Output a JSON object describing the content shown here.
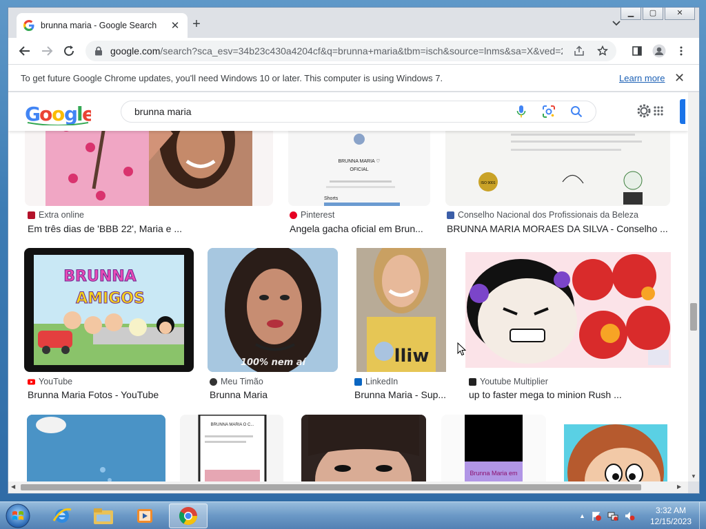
{
  "browser": {
    "tab_title": "brunna maria - Google Search",
    "url_host": "google.com",
    "url_path": "/search?sca_esv=34b23c430a4204cf&q=brunna+maria&tbm=isch&source=lnms&sa=X&ved=2...",
    "infobar_text": "To get future Google Chrome updates, you'll need Windows 10 or later. This computer is using Windows 7.",
    "infobar_link": "Learn more"
  },
  "search": {
    "query": "brunna maria"
  },
  "results": [
    {
      "source": "Extra online",
      "title": "Em três dias de 'BBB 22', Maria e ...",
      "src_color": "#b3122a"
    },
    {
      "source": "Pinterest",
      "title": "Angela gacha oficial em Brun...",
      "src_color": "#e60023"
    },
    {
      "source": "Conselho Nacional dos Profissionais da Beleza",
      "title": "BRUNNA MARIA MORAES DA SILVA - Conselho ...",
      "src_color": "#3b5ea8"
    },
    {
      "source": "YouTube",
      "title": "Brunna Maria Fotos - YouTube",
      "src_color": "#ff0000"
    },
    {
      "source": "Meu Timão",
      "title": "Brunna Maria",
      "src_color": "#333333"
    },
    {
      "source": "LinkedIn",
      "title": "Brunna Maria - Sup...",
      "src_color": "#0a66c2"
    },
    {
      "source": "Youtube Multiplier",
      "title": "up to faster mega to minion Rush ...",
      "src_color": "#222222"
    }
  ],
  "thumb_text": {
    "pinterest_name": "BRUNNA MARIA ♡",
    "pinterest_sub": "OFICIAL",
    "pinterest_shorts": "Shorts",
    "cert_seal": "ISO 9001",
    "yt_title_1": "BRUNNA",
    "yt_title_2": "AMIGOS",
    "meutimao_caption": "100% nem aí",
    "shirt_text": "lliw",
    "phone_title": "BRUNNA MARIA O C...",
    "bottom_label": "Brunna Maria em"
  },
  "taskbar": {
    "time": "3:32 AM",
    "date": "12/15/2023"
  },
  "colors": {
    "google_blue": "#4285f4",
    "google_red": "#ea4335",
    "google_yellow": "#fbbc05",
    "google_green": "#34a853",
    "link_blue": "#1a5fb4"
  }
}
